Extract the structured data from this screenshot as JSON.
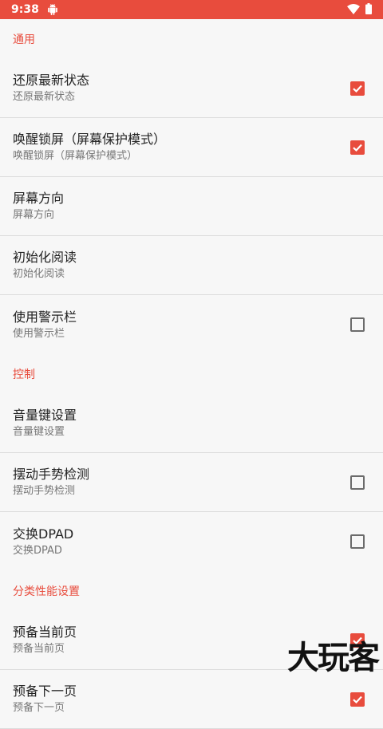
{
  "status_bar": {
    "time": "9:38",
    "icons": [
      "android-icon",
      "wifi-icon",
      "battery-icon"
    ],
    "color": "#e84c3d"
  },
  "sections": [
    {
      "header": "通用",
      "items": [
        {
          "title": "还原最新状态",
          "subtitle": "还原最新状态",
          "checkbox": true,
          "checked": true
        },
        {
          "title": "唤醒锁屏（屏幕保护模式）",
          "subtitle": "唤醒锁屏（屏幕保护模式）",
          "checkbox": true,
          "checked": true
        },
        {
          "title": "屏幕方向",
          "subtitle": "屏幕方向",
          "checkbox": false
        },
        {
          "title": "初始化阅读",
          "subtitle": "初始化阅读",
          "checkbox": false
        },
        {
          "title": "使用警示栏",
          "subtitle": "使用警示栏",
          "checkbox": true,
          "checked": false
        }
      ]
    },
    {
      "header": "控制",
      "items": [
        {
          "title": "音量键设置",
          "subtitle": "音量键设置",
          "checkbox": false
        },
        {
          "title": "摆动手势检测",
          "subtitle": "摆动手势检测",
          "checkbox": true,
          "checked": false
        },
        {
          "title": "交换DPAD",
          "subtitle": "交换DPAD",
          "checkbox": true,
          "checked": false
        }
      ]
    },
    {
      "header": "分类性能设置",
      "items": [
        {
          "title": "预备当前页",
          "subtitle": "预备当前页",
          "checkbox": true,
          "checked": true
        },
        {
          "title": "预备下一页",
          "subtitle": "预备下一页",
          "checkbox": true,
          "checked": true
        }
      ]
    }
  ],
  "watermark": "大玩客",
  "accent_color": "#e84c3d"
}
